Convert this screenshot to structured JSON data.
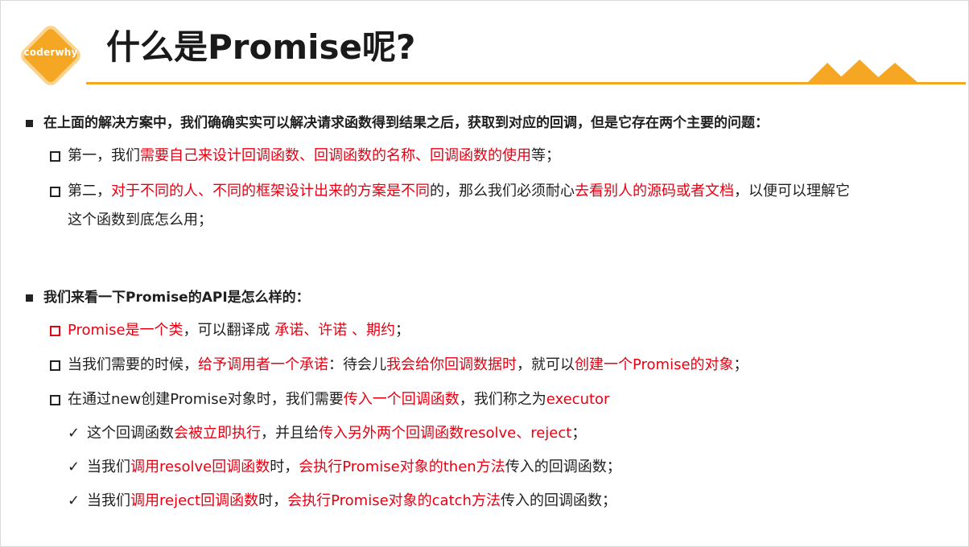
{
  "logo": {
    "text": "coderwhy",
    "color": "#f5a623"
  },
  "title": "什么是Promise呢?",
  "accent_color": "#f5a623",
  "highlight_color": "#e60012",
  "section1": {
    "heading": "在上面的解决方案中，我们确确实实可以解决请求函数得到结果之后，获取到对应的回调，但是它存在两个主要的问题：",
    "items": [
      {
        "parts": [
          {
            "text": "第一，我们",
            "red": false
          },
          {
            "text": "需要自己来设计回调函数、回调函数的名称、回调函数的使用",
            "red": true
          },
          {
            "text": "等；",
            "red": false
          }
        ]
      },
      {
        "parts": [
          {
            "text": "第二，",
            "red": false
          },
          {
            "text": "对于不同的人、不同的框架设计出来的方案是不同",
            "red": true
          },
          {
            "text": "的，那么我们必须耐心",
            "red": false
          },
          {
            "text": "去看别人的源码或者文档",
            "red": true
          },
          {
            "text": "，以便可以理解它",
            "red": false
          }
        ],
        "continuation": "这个函数到底怎么用；"
      }
    ]
  },
  "section2": {
    "heading": "我们来看一下Promise的API是怎么样的：",
    "items": [
      {
        "red_bullet": true,
        "parts": [
          {
            "text": "Promise是一个类",
            "red": true
          },
          {
            "text": "，可以翻译成 ",
            "red": false
          },
          {
            "text": "承诺、许诺 、期约",
            "red": true
          },
          {
            "text": "；",
            "red": false
          }
        ]
      },
      {
        "red_bullet": false,
        "parts": [
          {
            "text": "当我们需要的时候，",
            "red": false
          },
          {
            "text": "给予调用者一个承诺",
            "red": true
          },
          {
            "text": "：待会儿",
            "red": false
          },
          {
            "text": "我会给你回调数据时",
            "red": true
          },
          {
            "text": "，就可以",
            "red": false
          },
          {
            "text": "创建一个Promise的对象",
            "red": true
          },
          {
            "text": "；",
            "red": false
          }
        ]
      },
      {
        "red_bullet": false,
        "parts": [
          {
            "text": "在通过new创建Promise对象时，我们需要",
            "red": false
          },
          {
            "text": "传入一个回调函数",
            "red": true
          },
          {
            "text": "，我们称之为",
            "red": false
          },
          {
            "text": "executor",
            "red": true
          }
        ]
      }
    ],
    "sub_items": [
      {
        "parts": [
          {
            "text": "这个回调函数",
            "red": false
          },
          {
            "text": "会被立即执行",
            "red": true
          },
          {
            "text": "，并且给",
            "red": false
          },
          {
            "text": "传入另外两个回调函数resolve、reject",
            "red": true
          },
          {
            "text": "；",
            "red": false
          }
        ]
      },
      {
        "parts": [
          {
            "text": "当我们",
            "red": false
          },
          {
            "text": "调用resolve回调函数",
            "red": true
          },
          {
            "text": "时，",
            "red": false
          },
          {
            "text": "会执行Promise对象的then方法",
            "red": true
          },
          {
            "text": "传入的回调函数；",
            "red": false
          }
        ]
      },
      {
        "parts": [
          {
            "text": "当我们",
            "red": false
          },
          {
            "text": "调用reject回调函数",
            "red": true
          },
          {
            "text": "时，",
            "red": false
          },
          {
            "text": "会执行Promise对象的catch方法",
            "red": true
          },
          {
            "text": "传入的回调函数；",
            "red": false
          }
        ]
      }
    ]
  }
}
